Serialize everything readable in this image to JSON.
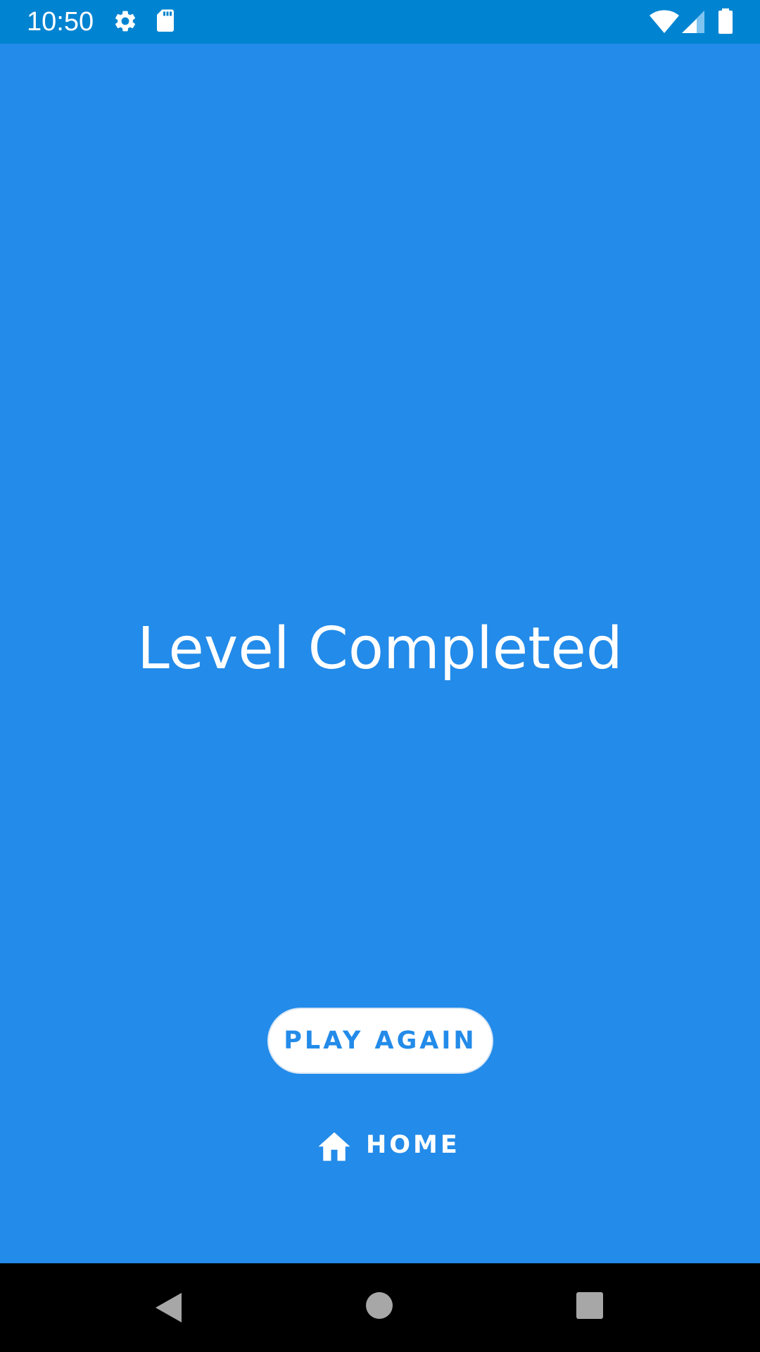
{
  "status_bar": {
    "time": "10:50",
    "icons": [
      "gear-icon",
      "sd-card-icon",
      "wifi-icon",
      "cell-signal-icon",
      "battery-icon"
    ]
  },
  "main": {
    "title": "Level Completed",
    "play_again_label": "PLAY AGAIN",
    "home_label": "HOME",
    "home_icon": "home-icon"
  },
  "nav_bar": {
    "icons": [
      "back-icon",
      "home-circle-icon",
      "recents-icon"
    ]
  },
  "colors": {
    "background": "#238BE9",
    "status_bar": "#0084D1",
    "button_bg": "#FFFFFF",
    "button_text": "#238BE9",
    "nav_bar": "#000000"
  }
}
